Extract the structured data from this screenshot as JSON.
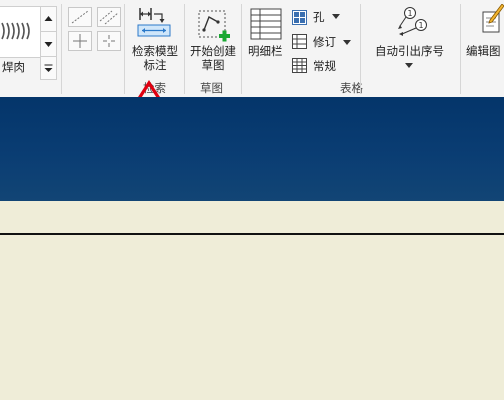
{
  "ribbon": {
    "weld_label": "焊肉",
    "retrieve_annotation": {
      "line1": "检索模型",
      "line2": "标注"
    },
    "retrieve_group": "检索",
    "start_sketch": {
      "line1": "开始创建",
      "line2": "草图"
    },
    "sketch_group": "草图",
    "detail_list": "明细栏",
    "hole": "孔",
    "revision": "修订",
    "general": "常规",
    "table_group": "表格",
    "auto_balloon": "自动引出序号",
    "edit_drawing": "编辑图"
  },
  "colors": {
    "ribbon_bg": "#f4f4f4",
    "title_blue": "#04356a",
    "canvas_bg": "#efedd8",
    "arrow": "#e00010",
    "plus_green": "#19a832"
  }
}
